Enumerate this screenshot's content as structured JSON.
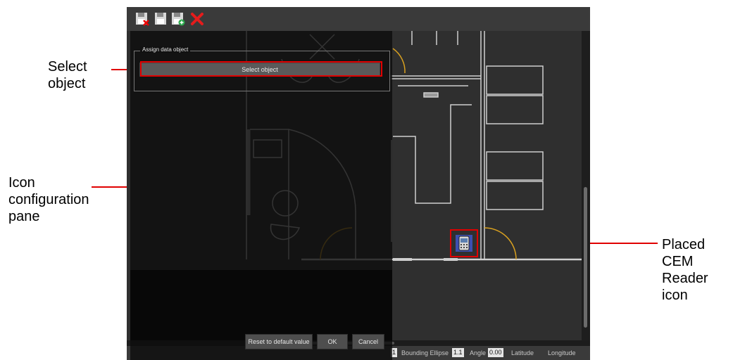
{
  "callouts": {
    "select_object": [
      "Select",
      "object"
    ],
    "icon_pane": [
      "Icon",
      "configuration",
      "pane"
    ],
    "placed_reader": [
      "Placed",
      "CEM",
      "Reader",
      "icon"
    ]
  },
  "toolbar": {
    "icons": [
      "save-close-icon",
      "save-icon",
      "save-add-icon",
      "close-red-x-icon"
    ]
  },
  "pane": {
    "group_title": "Assign data object",
    "select_button": "Select object",
    "reset_button": "Reset to default value",
    "ok_button": "OK",
    "cancel_button": "Cancel"
  },
  "statusbar": {
    "value_left": "1",
    "bounding_ellipse_label": "Bounding Ellipse",
    "bounding_ellipse_value": "1.1",
    "angle_label": "Angle",
    "angle_value": "0.00",
    "latitude_label": "Latitude",
    "longitude_label": "Longitude"
  },
  "colors": {
    "callout_red": "#e00000",
    "floorplan_line": "#cfcfcf",
    "door_arc": "#d8a020",
    "reader_blue": "#3c4fb0"
  }
}
